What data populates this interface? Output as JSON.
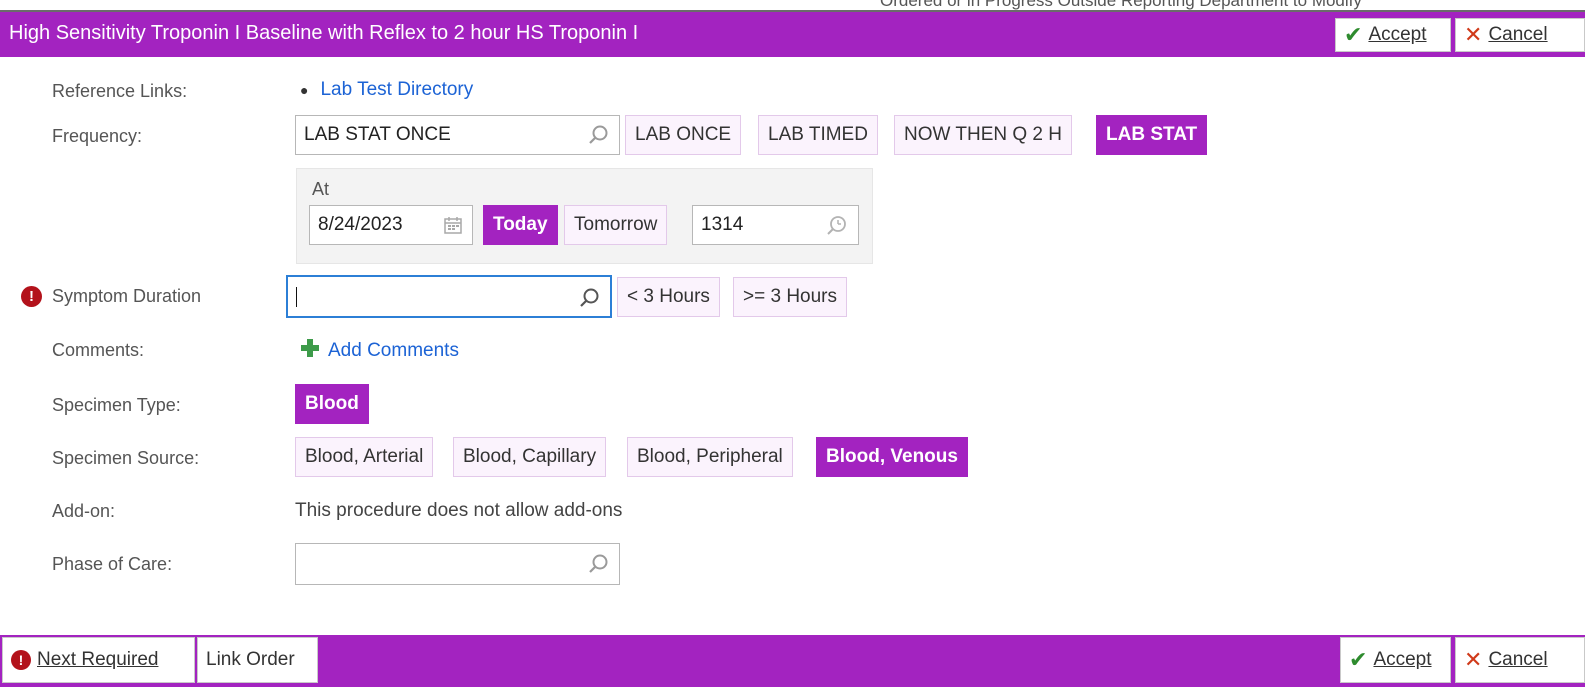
{
  "background_text": "Ordered or in Progress   Outside Reporting Department to Modify",
  "header": {
    "title": "High Sensitivity Troponin I Baseline with Reflex to 2 hour HS Troponin I",
    "accept_label": "Accept",
    "cancel_label": "Cancel"
  },
  "form": {
    "reference_links": {
      "label": "Reference Links:",
      "items": [
        "Lab Test Directory"
      ]
    },
    "frequency": {
      "label": "Frequency:",
      "value": "LAB STAT ONCE",
      "options": [
        "LAB ONCE",
        "LAB TIMED",
        "NOW THEN Q 2 H",
        "LAB STAT"
      ],
      "selected": "LAB STAT"
    },
    "at": {
      "label": "At",
      "date": "8/24/2023",
      "today_label": "Today",
      "tomorrow_label": "Tomorrow",
      "time": "1314"
    },
    "symptom_duration": {
      "label": "Symptom Duration",
      "value": "",
      "required": true,
      "options": [
        "< 3 Hours",
        ">= 3 Hours"
      ]
    },
    "comments": {
      "label": "Comments:",
      "add_label": "Add Comments"
    },
    "specimen_type": {
      "label": "Specimen Type:",
      "options": [
        "Blood"
      ],
      "selected": "Blood"
    },
    "specimen_source": {
      "label": "Specimen Source:",
      "options": [
        "Blood, Arterial",
        "Blood, Capillary",
        "Blood, Peripheral",
        "Blood, Venous"
      ],
      "selected": "Blood, Venous"
    },
    "add_on": {
      "label": "Add-on:",
      "text": "This procedure does not allow add-ons"
    },
    "phase_of_care": {
      "label": "Phase of Care:",
      "value": ""
    }
  },
  "footer": {
    "next_required_label": "Next Required",
    "link_order_label": "Link Order",
    "accept_label": "Accept",
    "cancel_label": "Cancel"
  },
  "colors": {
    "accent": "#a323c0",
    "chip_bg": "#fbf3fd",
    "link": "#1c63d5",
    "required": "#b3121b",
    "focus": "#2c7fd6"
  },
  "icons": {
    "search": "magnifier-icon",
    "calendar": "calendar-icon",
    "time": "time-search-icon",
    "required": "exclamation-icon",
    "add": "plus-icon",
    "accept": "checkmark-icon",
    "cancel": "x-icon"
  }
}
